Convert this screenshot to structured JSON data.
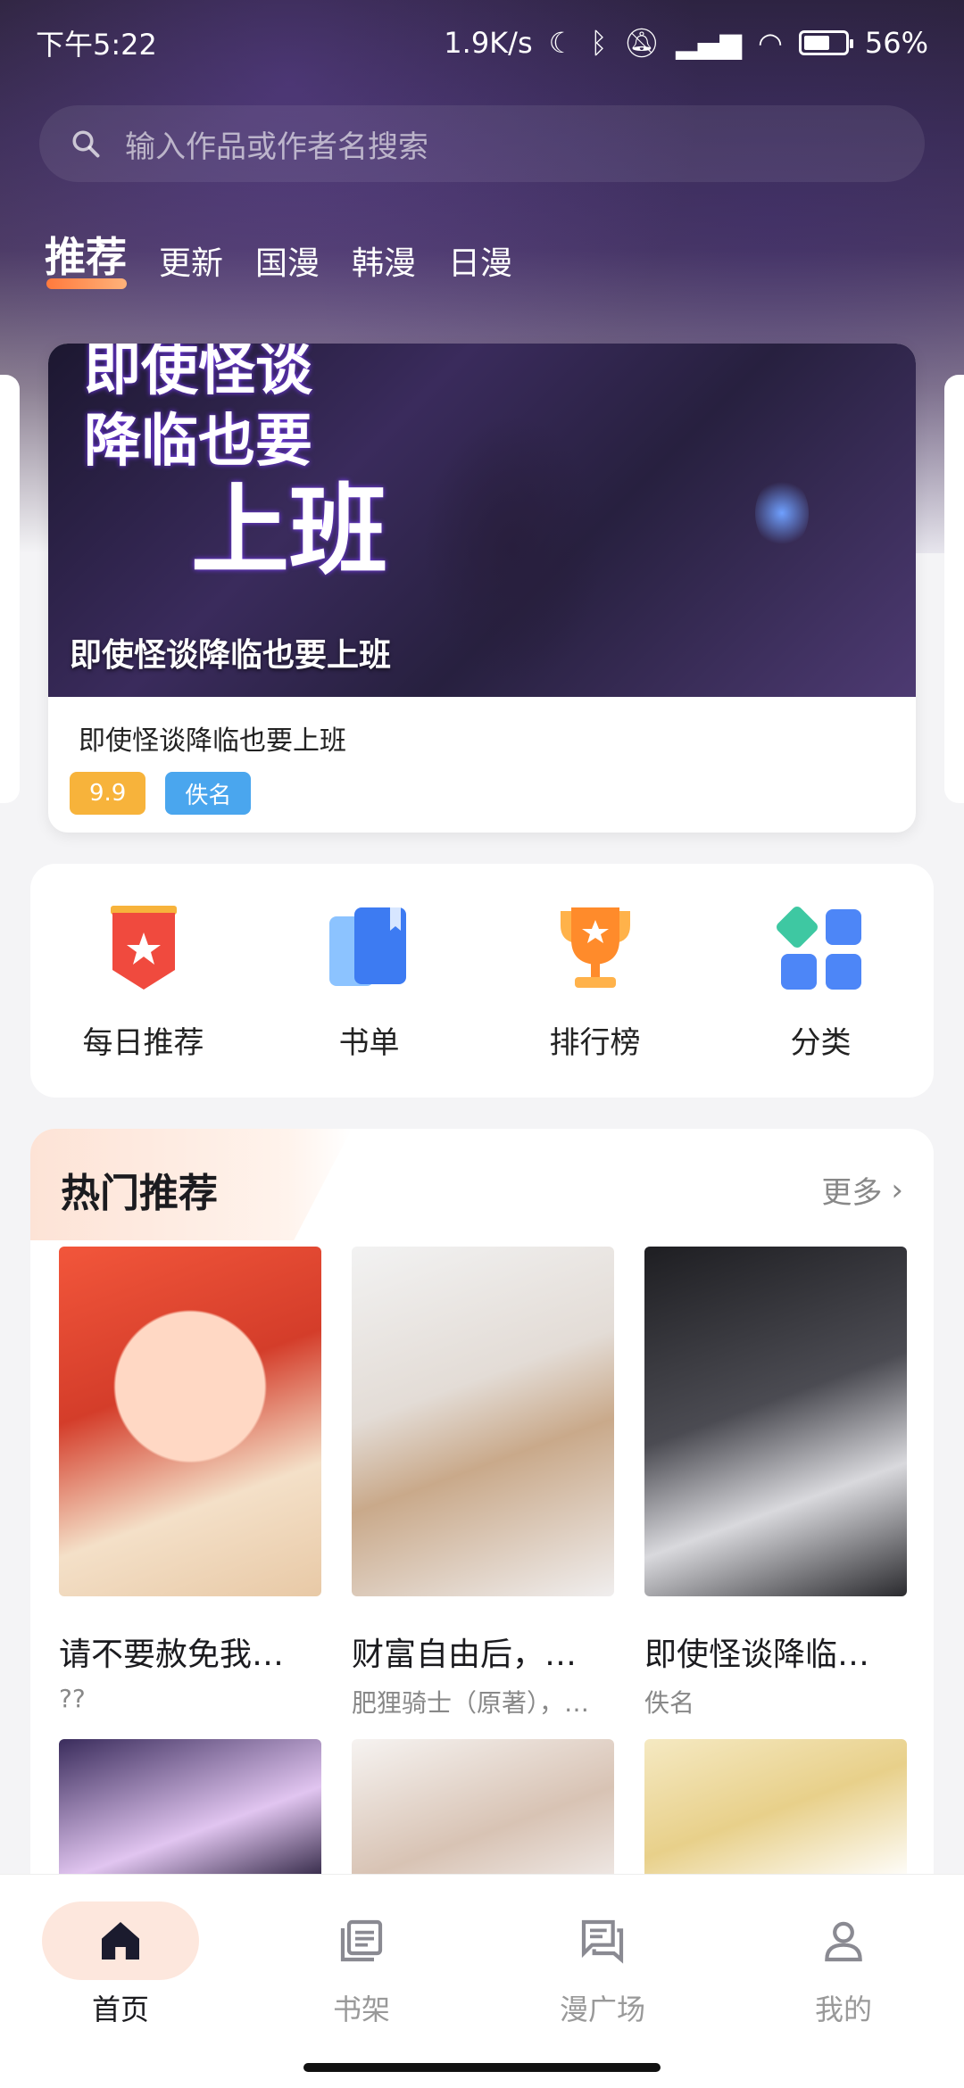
{
  "status_bar": {
    "time": "下午5:22",
    "network_speed": "1.9K/s",
    "battery": "56%"
  },
  "search": {
    "placeholder": "输入作品或作者名搜索"
  },
  "tabs": [
    {
      "label": "推荐",
      "active": true
    },
    {
      "label": "更新",
      "active": false
    },
    {
      "label": "国漫",
      "active": false
    },
    {
      "label": "韩漫",
      "active": false
    },
    {
      "label": "日漫",
      "active": false
    }
  ],
  "banner": {
    "art_text_line1": "即使怪谈",
    "art_text_line2": "降临也要",
    "art_text_line3": "上班",
    "overlay_title": "即使怪谈降临也要上班",
    "title": "即使怪谈降临也要上班",
    "score": "9.9",
    "author": "佚名"
  },
  "quick_menu": [
    {
      "label": "每日推荐",
      "icon": "daily-recommend-icon"
    },
    {
      "label": "书单",
      "icon": "book-list-icon"
    },
    {
      "label": "排行榜",
      "icon": "trophy-icon"
    },
    {
      "label": "分类",
      "icon": "category-icon"
    }
  ],
  "hot": {
    "title": "热门推荐",
    "more": "更多",
    "items": [
      {
        "title": "请不要赦免我…",
        "author": "??"
      },
      {
        "title": "财富自由后，…",
        "author": "肥狸骑士（原著），…"
      },
      {
        "title": "即使怪谈降临…",
        "author": "佚名"
      }
    ]
  },
  "bottom_nav": [
    {
      "label": "首页",
      "active": true,
      "icon": "home-icon"
    },
    {
      "label": "书架",
      "active": false,
      "icon": "bookshelf-icon"
    },
    {
      "label": "漫广场",
      "active": false,
      "icon": "square-chat-icon"
    },
    {
      "label": "我的",
      "active": false,
      "icon": "profile-icon"
    }
  ],
  "colors": {
    "accent": "#ff7a3d",
    "score_badge": "#f7b33b",
    "author_badge": "#4aa6ee",
    "nav_active_pill": "#fde7dd"
  }
}
